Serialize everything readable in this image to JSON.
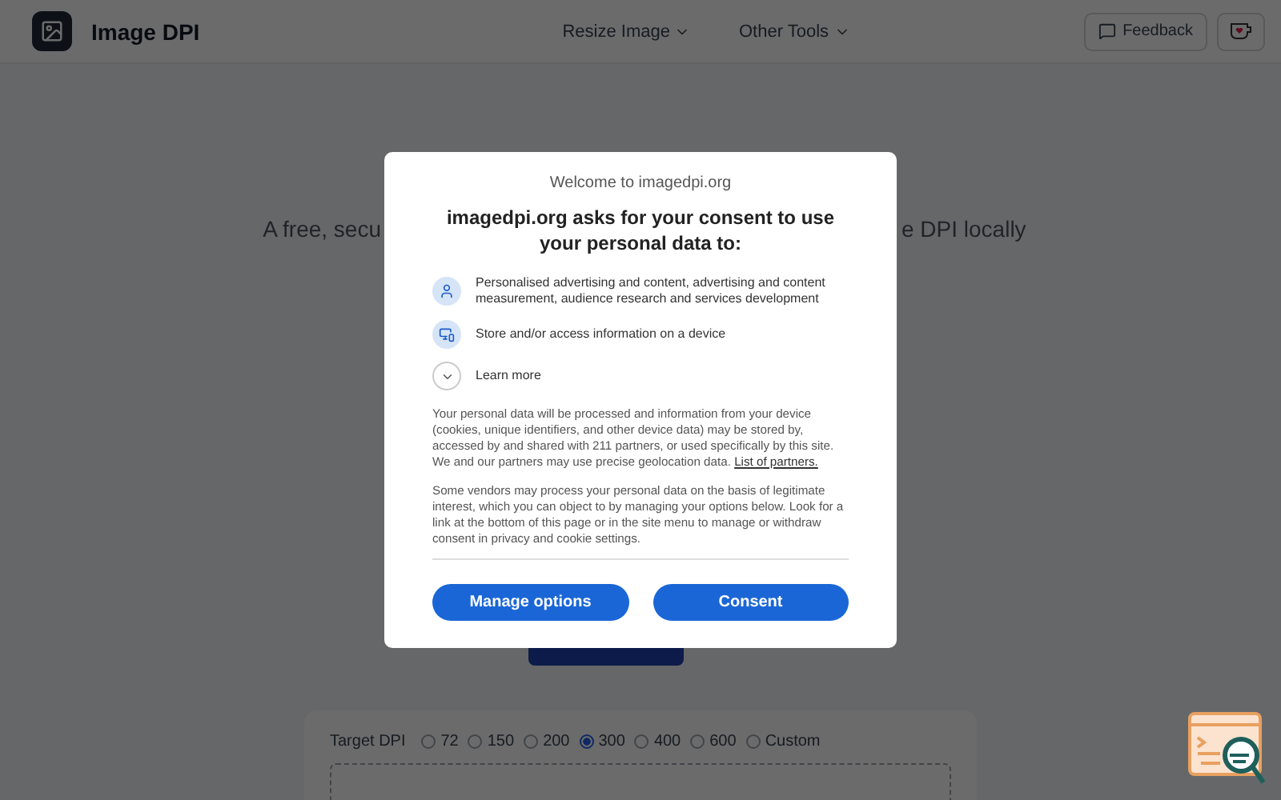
{
  "header": {
    "brand": "Image DPI",
    "nav": [
      {
        "label": "Resize Image"
      },
      {
        "label": "Other Tools"
      }
    ],
    "feedback": "Feedback"
  },
  "hero": {
    "subtitle_left": "A free, secu",
    "subtitle_right": "e DPI locally"
  },
  "settings": {
    "label": "Target DPI",
    "options": [
      {
        "label": "72",
        "selected": false
      },
      {
        "label": "150",
        "selected": false
      },
      {
        "label": "200",
        "selected": false
      },
      {
        "label": "300",
        "selected": true
      },
      {
        "label": "400",
        "selected": false
      },
      {
        "label": "600",
        "selected": false
      },
      {
        "label": "Custom",
        "selected": false
      }
    ]
  },
  "consent": {
    "welcome": "Welcome to imagedpi.org",
    "title": "imagedpi.org asks for your consent to use your personal data to:",
    "purposes": [
      {
        "kind": "person",
        "text": "Personalised advertising and content, advertising and content measurement, audience research and services development"
      },
      {
        "kind": "device",
        "text": "Store and/or access information on a device"
      }
    ],
    "learn_more": "Learn more",
    "paragraph_1": "Your personal data will be processed and information from your device (cookies, unique identifiers, and other device data) may be stored by, accessed by and shared with 211 partners, or used specifically by this site. We and our partners may use precise geolocation data.",
    "partners_link": "List of partners.",
    "paragraph_2": "Some vendors may process your personal data on the basis of legitimate interest, which you can object to by managing your options below. Look for a link at the bottom of this page or in the site menu to manage or withdraw consent in privacy and cookie settings.",
    "buttons": [
      "Manage options",
      "Consent"
    ]
  }
}
